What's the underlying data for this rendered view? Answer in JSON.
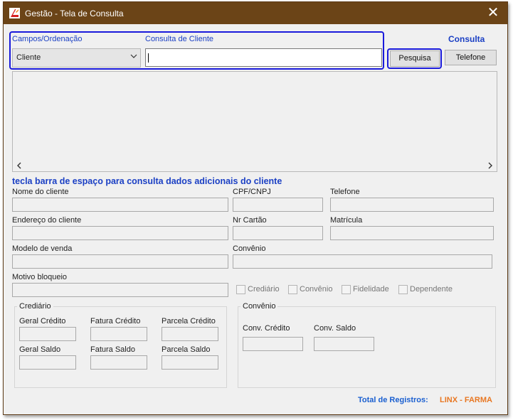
{
  "window": {
    "title": "Gestão - Tela de Consulta",
    "close_glyph": "✕"
  },
  "colors": {
    "titlebar": "#6b4417",
    "accent_blue": "#1a3fc4",
    "highlight": "#1a1adb",
    "brand_orange": "#e87722"
  },
  "search": {
    "fields_label": "Campos/Ordenação",
    "fields_value": "Cliente",
    "query_label": "Consulta de Cliente",
    "query_value": "",
    "mode_label": "Consulta",
    "search_button": "Pesquisa",
    "phone_button": "Telefone"
  },
  "hint": "tecla barra de espaço para consulta dados adicionais do cliente",
  "details": {
    "nome": "Nome do cliente",
    "cpf": "CPF/CNPJ",
    "telefone": "Telefone",
    "endereco": "Endereço do cliente",
    "cartao": "Nr Cartão",
    "matricula": "Matrícula",
    "modelo": "Modelo de venda",
    "convenio": "Convênio",
    "motivo": "Motivo bloqueio"
  },
  "flags": [
    "Crediário",
    "Convênio",
    "Fidelidade",
    "Dependente"
  ],
  "crediario": {
    "title": "Crediário",
    "geral_credito": "Geral Crédito",
    "fatura_credito": "Fatura Crédito",
    "parcela_credito": "Parcela Crédito",
    "geral_saldo": "Geral Saldo",
    "fatura_saldo": "Fatura Saldo",
    "parcela_saldo": "Parcela Saldo"
  },
  "convenio_group": {
    "title": "Convênio",
    "credito": "Conv. Crédito",
    "saldo": "Conv. Saldo"
  },
  "footer": {
    "total_label": "Total de Registros:",
    "brand": "LINX - FARMA"
  }
}
